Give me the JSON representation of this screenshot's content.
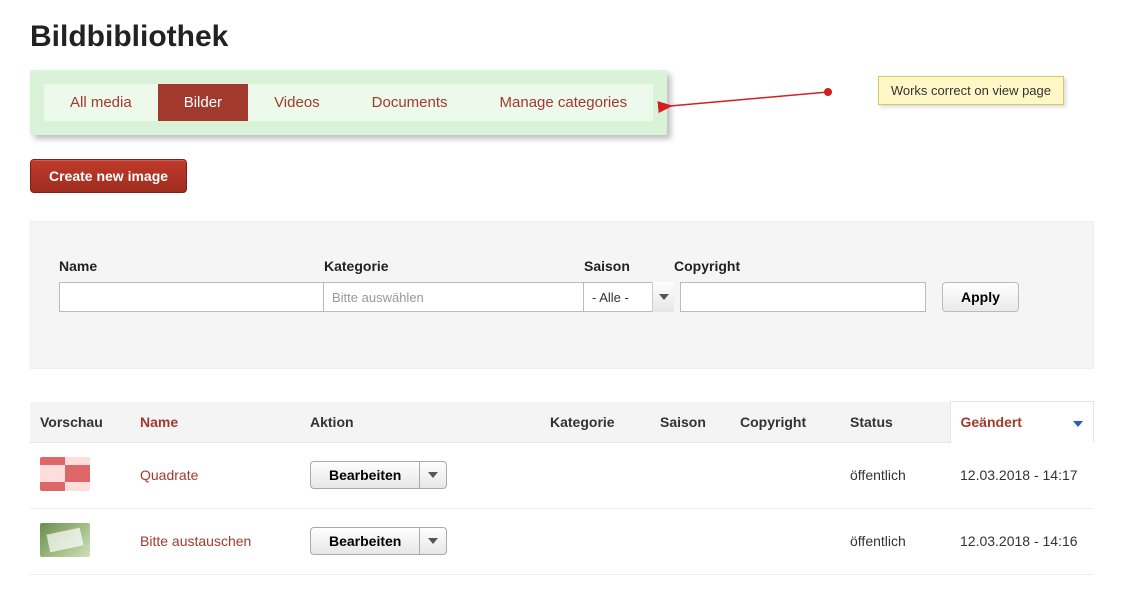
{
  "page": {
    "title": "Bildbibliothek"
  },
  "tabs": {
    "items": [
      {
        "label": "All media"
      },
      {
        "label": "Bilder"
      },
      {
        "label": "Videos"
      },
      {
        "label": "Documents"
      },
      {
        "label": "Manage categories"
      }
    ]
  },
  "actions": {
    "create_label": "Create new image"
  },
  "filters": {
    "name": {
      "label": "Name",
      "value": ""
    },
    "kategorie": {
      "label": "Kategorie",
      "placeholder": "Bitte auswählen"
    },
    "saison": {
      "label": "Saison",
      "selected": "- Alle -"
    },
    "copyright": {
      "label": "Copyright",
      "value": ""
    },
    "apply_label": "Apply"
  },
  "table": {
    "headers": {
      "vorschau": "Vorschau",
      "name": "Name",
      "aktion": "Aktion",
      "kategorie": "Kategorie",
      "saison": "Saison",
      "copyright": "Copyright",
      "status": "Status",
      "geaendert": "Geändert"
    },
    "action_button_label": "Bearbeiten",
    "rows": [
      {
        "name": "Quadrate",
        "kategorie": "",
        "saison": "",
        "copyright": "",
        "status": "öffentlich",
        "geaendert": "12.03.2018 - 14:17",
        "thumb": "quad"
      },
      {
        "name": "Bitte austauschen",
        "kategorie": "",
        "saison": "",
        "copyright": "",
        "status": "öffentlich",
        "geaendert": "12.03.2018 - 14:16",
        "thumb": "photo"
      }
    ]
  },
  "annotation": {
    "text": "Works correct on view page"
  }
}
